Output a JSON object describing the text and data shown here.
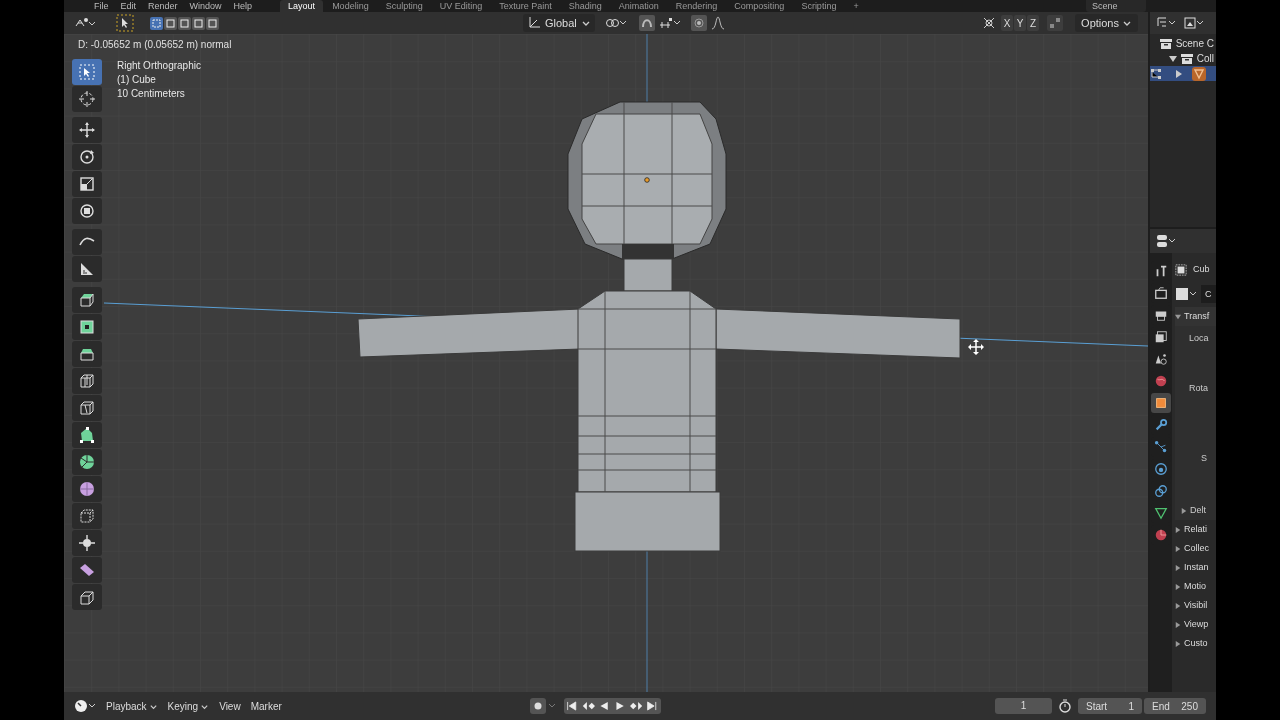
{
  "top_bar": {
    "menus": [
      "File",
      "Edit",
      "Render",
      "Window",
      "Help"
    ],
    "workspace_tabs": [
      {
        "label": "Layout",
        "selected": true
      },
      {
        "label": "Modeling",
        "selected": false
      },
      {
        "label": "Sculpting",
        "selected": false
      },
      {
        "label": "UV Editing",
        "selected": false
      },
      {
        "label": "Texture Paint",
        "selected": false
      },
      {
        "label": "Shading",
        "selected": false
      },
      {
        "label": "Animation",
        "selected": false
      },
      {
        "label": "Rendering",
        "selected": false
      },
      {
        "label": "Compositing",
        "selected": false
      },
      {
        "label": "Scripting",
        "selected": false
      },
      {
        "label": "+",
        "selected": false
      }
    ],
    "scene": "Scene"
  },
  "viewport_header": {
    "transform_orientation": "Global",
    "axes": [
      "X",
      "Y",
      "Z"
    ],
    "options": "Options"
  },
  "viewport": {
    "status_text": "D: -0.05652 m (0.05652 m) normal",
    "info": [
      "Right Orthographic",
      "(1) Cube",
      "10 Centimeters"
    ],
    "tool_groups": [
      {
        "tools": [
          {
            "kind": "select",
            "selected": true
          },
          {
            "kind": "cursor",
            "selected": false
          }
        ]
      },
      {
        "tools": [
          {
            "kind": "move",
            "selected": false
          },
          {
            "kind": "rotate",
            "selected": false
          },
          {
            "kind": "scale",
            "selected": false
          },
          {
            "kind": "transform",
            "selected": false
          }
        ]
      },
      {
        "tools": [
          {
            "kind": "annotate",
            "selected": false
          },
          {
            "kind": "measure",
            "selected": false
          }
        ]
      },
      {
        "tools": [
          {
            "kind": "extrude",
            "selected": false
          },
          {
            "kind": "inset",
            "selected": false
          },
          {
            "kind": "bevel",
            "selected": false
          },
          {
            "kind": "loopcut",
            "selected": false
          },
          {
            "kind": "knife",
            "selected": false
          },
          {
            "kind": "polybuild",
            "selected": false
          },
          {
            "kind": "spin",
            "selected": false
          },
          {
            "kind": "smooth",
            "selected": false
          },
          {
            "kind": "slide",
            "selected": false
          },
          {
            "kind": "shrink",
            "selected": false
          },
          {
            "kind": "shear",
            "selected": false
          },
          {
            "kind": "rip",
            "selected": false
          }
        ]
      }
    ]
  },
  "outliner": {
    "items": [
      {
        "label": "Scene C",
        "selected": false,
        "children": [
          {
            "label": "Coll",
            "selected": false,
            "expanded": true,
            "children": [
              {
                "kind": "mesh",
                "selected": true,
                "expanded": false
              }
            ]
          }
        ]
      }
    ]
  },
  "properties": {
    "tabs": [
      {
        "kind": "tool",
        "selected": false
      },
      {
        "kind": "render",
        "selected": false
      },
      {
        "kind": "output",
        "selected": false
      },
      {
        "kind": "view_layer",
        "selected": false
      },
      {
        "kind": "scene",
        "selected": false
      },
      {
        "kind": "world",
        "selected": false
      },
      {
        "kind": "object",
        "selected": true
      },
      {
        "kind": "modifiers",
        "selected": false
      },
      {
        "kind": "particles",
        "selected": false
      },
      {
        "kind": "physics",
        "selected": false
      },
      {
        "kind": "constraints",
        "selected": false
      },
      {
        "kind": "data",
        "selected": false
      },
      {
        "kind": "material",
        "selected": false
      }
    ],
    "object_name": "Cub",
    "data_name": "C",
    "sections": [
      {
        "label": "Transf",
        "expanded": true,
        "fields": [
          "Loca",
          "Rota",
          "S"
        ],
        "subsections": [
          {
            "label": "Delt",
            "expanded": false
          }
        ]
      },
      {
        "label": "Relati",
        "expanded": false
      },
      {
        "label": "Collec",
        "expanded": false
      },
      {
        "label": "Instan",
        "expanded": false
      },
      {
        "label": "Motio",
        "expanded": false
      },
      {
        "label": "Visibil",
        "expanded": false
      },
      {
        "label": "Viewp",
        "expanded": false
      },
      {
        "label": "Custo",
        "expanded": false
      }
    ]
  },
  "timeline": {
    "menus": [
      {
        "label": "Playback",
        "dropdown": true
      },
      {
        "label": "Keying",
        "dropdown": true
      },
      {
        "label": "View",
        "dropdown": false
      },
      {
        "label": "Marker",
        "dropdown": false
      }
    ],
    "current_frame": "1",
    "start_label": "Start",
    "start": "1",
    "end_label": "End",
    "end": "250"
  }
}
